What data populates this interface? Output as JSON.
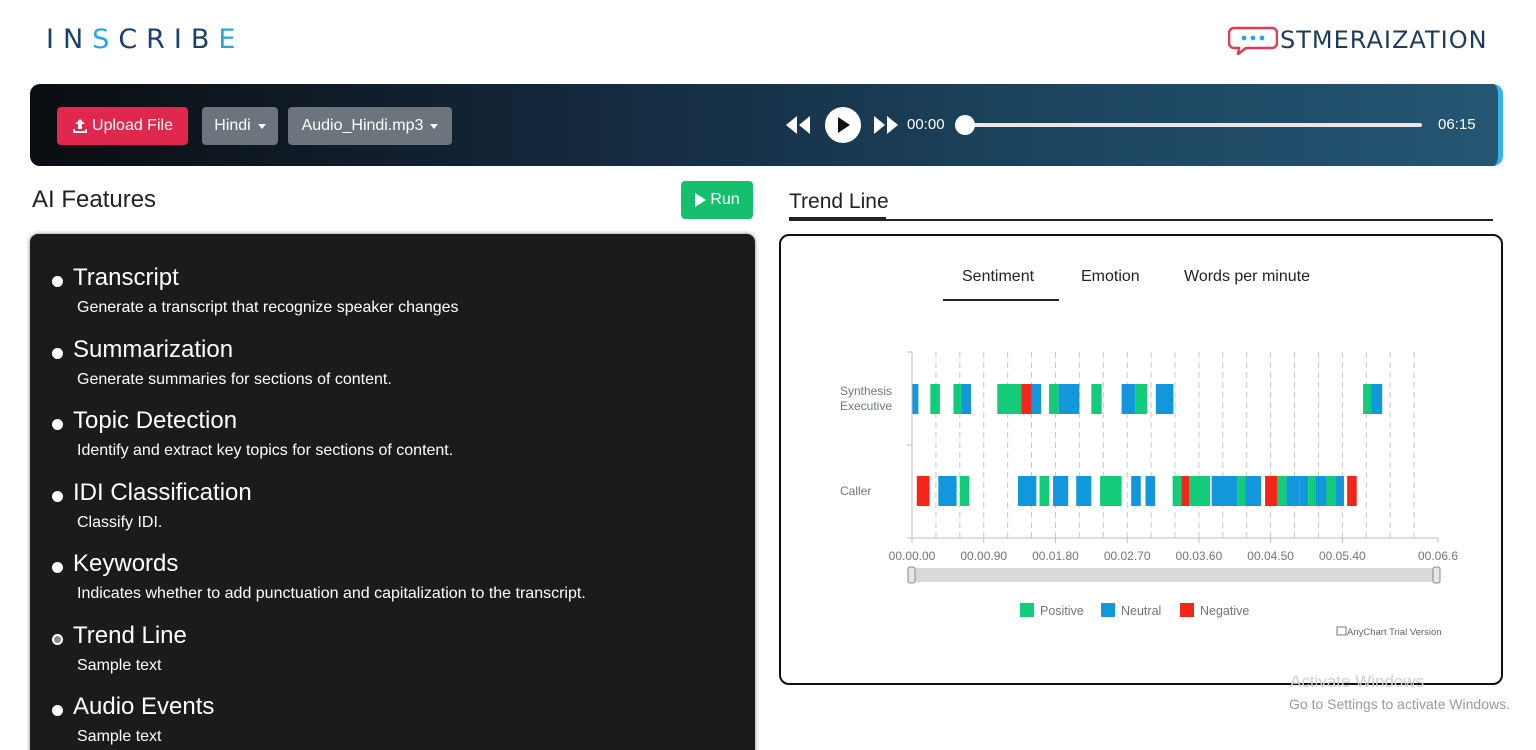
{
  "header": {
    "logo_left_a": "IN",
    "logo_left_b": "S",
    "logo_left_c": "CRIB",
    "logo_left_d": "E",
    "logo_right_text": "STMERAIZATION"
  },
  "player": {
    "upload_label": "Upload File",
    "language": "Hindi",
    "file": "Audio_Hindi.mp3",
    "time_current": "00:00",
    "time_total": "06:15",
    "progress": 0
  },
  "ai_features": {
    "title": "AI Features",
    "run_label": "Run",
    "items": [
      {
        "title": "Transcript",
        "desc": "Generate a transcript that recognize speaker changes",
        "selected": false
      },
      {
        "title": "Summarization",
        "desc": "Generate summaries for sections of content.",
        "selected": false
      },
      {
        "title": "Topic Detection",
        "desc": "Identify and extract key topics for sections of content.",
        "selected": false
      },
      {
        "title": "IDI Classification",
        "desc": "Classify IDI.",
        "selected": false
      },
      {
        "title": "Keywords",
        "desc": "Indicates whether to add punctuation and capitalization to the transcript.",
        "selected": false
      },
      {
        "title": "Trend Line",
        "desc": "Sample text",
        "selected": true
      },
      {
        "title": "Audio Events",
        "desc": "Sample text",
        "selected": false
      }
    ]
  },
  "trend": {
    "heading": "Trend Line",
    "tabs": [
      "Sentiment",
      "Emotion",
      "Words per minute"
    ],
    "active_tab": "Sentiment",
    "credit": "AnyChart Trial Version"
  },
  "chart_data": {
    "type": "bar",
    "orientation": "timeline",
    "categories": [
      "Synthesis Executive",
      "Caller"
    ],
    "x_tick_labels": [
      "00.00.00",
      "00.00.90",
      "00.01.80",
      "00.02.70",
      "00.03.60",
      "00.04.50",
      "00.05.40",
      "00.06.6"
    ],
    "xlim": [
      0,
      6.6
    ],
    "grid": true,
    "legend": [
      "Positive",
      "Neutral",
      "Negative"
    ],
    "legend_position": "bottom",
    "colors": {
      "Positive": "#13cc7a",
      "Neutral": "#1296dc",
      "Negative": "#f32617"
    },
    "series": [
      {
        "row": "Synthesis Executive",
        "segments": [
          {
            "start": 0.0,
            "end": 0.08,
            "sentiment": "Neutral"
          },
          {
            "start": 0.23,
            "end": 0.35,
            "sentiment": "Positive"
          },
          {
            "start": 0.52,
            "end": 0.62,
            "sentiment": "Positive"
          },
          {
            "start": 0.62,
            "end": 0.74,
            "sentiment": "Neutral"
          },
          {
            "start": 1.07,
            "end": 1.37,
            "sentiment": "Positive"
          },
          {
            "start": 1.37,
            "end": 1.5,
            "sentiment": "Negative"
          },
          {
            "start": 1.5,
            "end": 1.62,
            "sentiment": "Neutral"
          },
          {
            "start": 1.72,
            "end": 1.84,
            "sentiment": "Positive"
          },
          {
            "start": 1.84,
            "end": 2.1,
            "sentiment": "Neutral"
          },
          {
            "start": 2.25,
            "end": 2.38,
            "sentiment": "Positive"
          },
          {
            "start": 2.63,
            "end": 2.8,
            "sentiment": "Neutral"
          },
          {
            "start": 2.8,
            "end": 2.95,
            "sentiment": "Positive"
          },
          {
            "start": 3.06,
            "end": 3.28,
            "sentiment": "Neutral"
          },
          {
            "start": 5.66,
            "end": 5.76,
            "sentiment": "Positive"
          },
          {
            "start": 5.76,
            "end": 5.9,
            "sentiment": "Neutral"
          }
        ]
      },
      {
        "row": "Caller",
        "segments": [
          {
            "start": 0.06,
            "end": 0.22,
            "sentiment": "Negative"
          },
          {
            "start": 0.33,
            "end": 0.56,
            "sentiment": "Neutral"
          },
          {
            "start": 0.6,
            "end": 0.72,
            "sentiment": "Positive"
          },
          {
            "start": 1.33,
            "end": 1.56,
            "sentiment": "Neutral"
          },
          {
            "start": 1.6,
            "end": 1.72,
            "sentiment": "Positive"
          },
          {
            "start": 1.77,
            "end": 1.96,
            "sentiment": "Neutral"
          },
          {
            "start": 2.06,
            "end": 2.25,
            "sentiment": "Neutral"
          },
          {
            "start": 2.36,
            "end": 2.63,
            "sentiment": "Positive"
          },
          {
            "start": 2.75,
            "end": 2.87,
            "sentiment": "Neutral"
          },
          {
            "start": 2.93,
            "end": 3.05,
            "sentiment": "Neutral"
          },
          {
            "start": 3.27,
            "end": 3.38,
            "sentiment": "Positive"
          },
          {
            "start": 3.38,
            "end": 3.48,
            "sentiment": "Negative"
          },
          {
            "start": 3.48,
            "end": 3.74,
            "sentiment": "Positive"
          },
          {
            "start": 3.76,
            "end": 4.08,
            "sentiment": "Neutral"
          },
          {
            "start": 4.08,
            "end": 4.18,
            "sentiment": "Positive"
          },
          {
            "start": 4.18,
            "end": 4.38,
            "sentiment": "Neutral"
          },
          {
            "start": 4.43,
            "end": 4.58,
            "sentiment": "Negative"
          },
          {
            "start": 4.58,
            "end": 4.7,
            "sentiment": "Positive"
          },
          {
            "start": 4.7,
            "end": 4.86,
            "sentiment": "Neutral"
          },
          {
            "start": 4.86,
            "end": 4.97,
            "sentiment": "Neutral"
          },
          {
            "start": 4.97,
            "end": 5.06,
            "sentiment": "Positive"
          },
          {
            "start": 5.06,
            "end": 5.2,
            "sentiment": "Neutral"
          },
          {
            "start": 5.2,
            "end": 5.32,
            "sentiment": "Positive"
          },
          {
            "start": 5.32,
            "end": 5.42,
            "sentiment": "Neutral"
          },
          {
            "start": 5.46,
            "end": 5.58,
            "sentiment": "Negative"
          }
        ]
      }
    ]
  },
  "os_overlay": {
    "line1": "Activate Windows",
    "line2": "Go to Settings to activate Windows."
  }
}
